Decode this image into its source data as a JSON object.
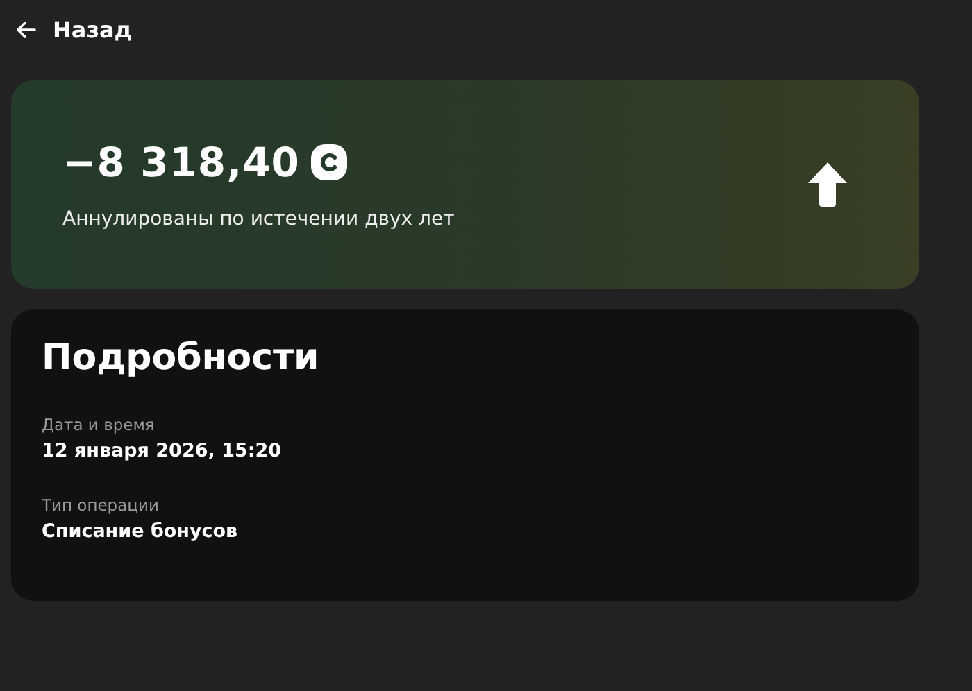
{
  "header": {
    "back_label": "Назад"
  },
  "summary": {
    "amount": "−8 318,40",
    "caption": "Аннулированы по истечении двух лет"
  },
  "details": {
    "title": "Подробности",
    "fields": [
      {
        "label": "Дата и время",
        "value": "12 января 2026, 15:20"
      },
      {
        "label": "Тип операции",
        "value": "Списание бонусов"
      }
    ]
  }
}
